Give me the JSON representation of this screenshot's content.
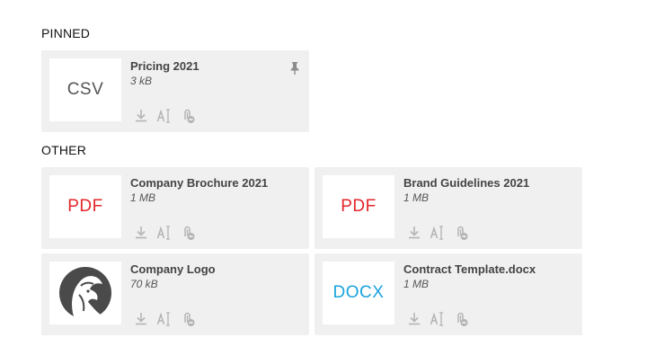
{
  "sections": {
    "pinned": "PINNED",
    "other": "OTHER"
  },
  "files": {
    "pricing": {
      "name": "Pricing 2021",
      "size": "3 kB",
      "thumb_label": "CSV"
    },
    "brochure": {
      "name": "Company Brochure 2021",
      "size": "1 MB",
      "thumb_label": "PDF"
    },
    "guidelines": {
      "name": "Brand Guidelines 2021",
      "size": "1 MB",
      "thumb_label": "PDF"
    },
    "logo": {
      "name": "Company Logo",
      "size": "70 kB"
    },
    "contract": {
      "name": "Contract Template.docx",
      "size": "1 MB",
      "thumb_label": "DOCX"
    }
  },
  "icons": {
    "download": "download-icon",
    "rename": "rename-icon",
    "remove_attachment": "remove-attachment-icon",
    "pin": "pin-icon"
  },
  "colors": {
    "card_bg": "#f0f0f0",
    "pdf": "#e3262a",
    "docx": "#1aa3dc",
    "icon": "#b4b4b4"
  }
}
